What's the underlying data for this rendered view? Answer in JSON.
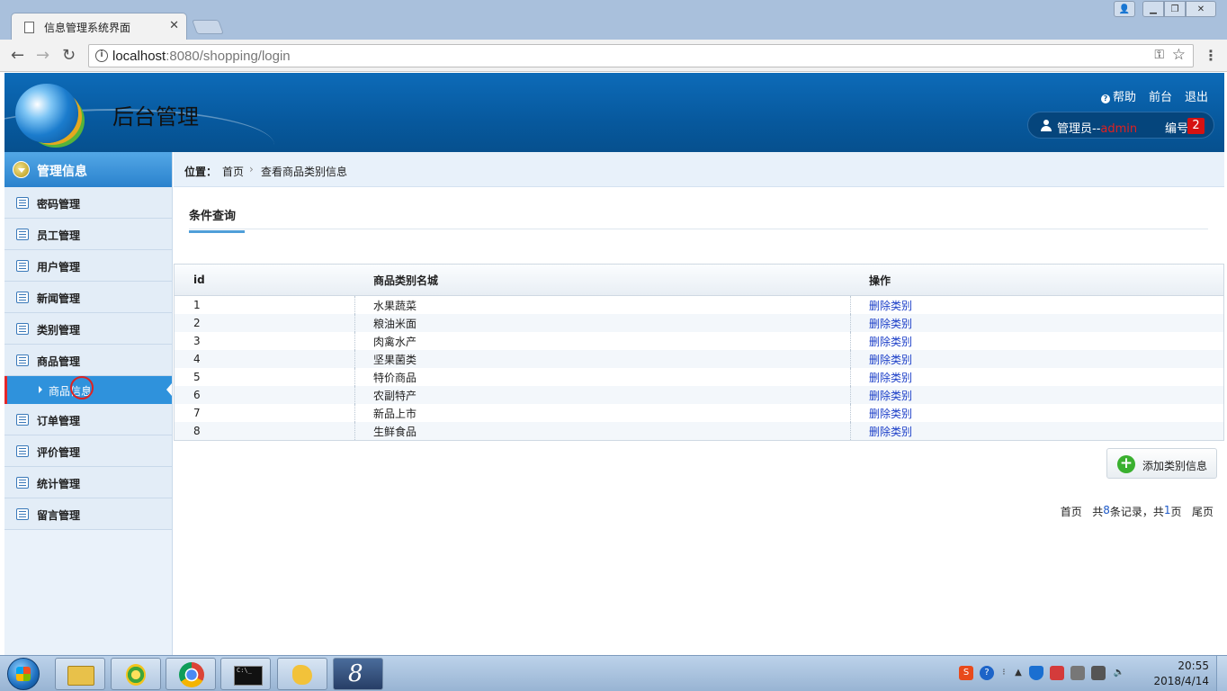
{
  "browser": {
    "tab_title": "信息管理系统界面",
    "url_host": "localhost",
    "url_path": ":8080/shopping/login"
  },
  "header": {
    "title": "后台管理",
    "help": "帮助",
    "front": "前台",
    "logout": "退出",
    "role_label": "管理员--",
    "username": "admin",
    "number_label": "编号",
    "number": "2"
  },
  "sidebar": {
    "head": "管理信息",
    "items": [
      {
        "label": "密码管理"
      },
      {
        "label": "员工管理"
      },
      {
        "label": "用户管理"
      },
      {
        "label": "新闻管理"
      },
      {
        "label": "类别管理"
      },
      {
        "label": "商品管理"
      }
    ],
    "sub_item": "商品信息",
    "items_after": [
      {
        "label": "订单管理"
      },
      {
        "label": "评价管理"
      },
      {
        "label": "统计管理"
      },
      {
        "label": "留言管理"
      }
    ]
  },
  "breadcrumb": {
    "label": "位置：",
    "home": "首页",
    "separator": "›",
    "current": "查看商品类别信息"
  },
  "query_tab": "条件查询",
  "table": {
    "headers": [
      "id",
      "商品类别名城",
      "操作"
    ],
    "rows": [
      {
        "id": "1",
        "name": "水果蔬菜",
        "action": "删除类别"
      },
      {
        "id": "2",
        "name": "粮油米面",
        "action": "删除类别"
      },
      {
        "id": "3",
        "name": "肉禽水产",
        "action": "删除类别"
      },
      {
        "id": "4",
        "name": "坚果菌类",
        "action": "删除类别"
      },
      {
        "id": "5",
        "name": "特价商品",
        "action": "删除类别"
      },
      {
        "id": "6",
        "name": "农副特产",
        "action": "删除类别"
      },
      {
        "id": "7",
        "name": "新品上市",
        "action": "删除类别"
      },
      {
        "id": "8",
        "name": "生鲜食品",
        "action": "删除类别"
      }
    ]
  },
  "add_button": "添加类别信息",
  "pager": {
    "first": "首页",
    "total_prefix": "共",
    "total_records": "8",
    "records_suffix": "条记录，共",
    "total_pages": "1",
    "pages_suffix": "页",
    "last": "尾页"
  },
  "taskbar": {
    "time": "20:55",
    "date": "2018/4/14"
  },
  "colors": {
    "header_blue": "#07599e",
    "sidebar_active": "#2f92dc",
    "link_blue": "#1c3fc8",
    "username_red": "#e02020",
    "badge_red": "#d51212"
  }
}
